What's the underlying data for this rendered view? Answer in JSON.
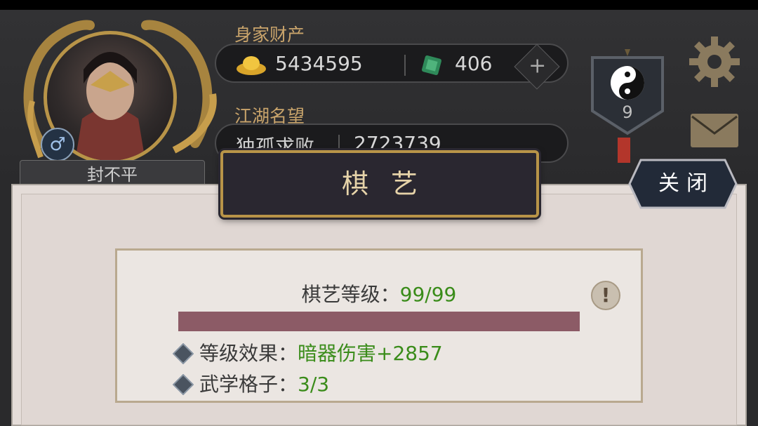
{
  "player": {
    "name": "封不平",
    "gender_symbol": "♂"
  },
  "wealth": {
    "label": "身家财产",
    "gold": "5434595",
    "jade": "406",
    "add_symbol": "+"
  },
  "reputation": {
    "label": "江湖名望",
    "title": "独孤求败",
    "value": "2723739"
  },
  "rank": {
    "level": "9"
  },
  "dialog": {
    "title": "棋艺",
    "close_label": "关闭",
    "level_label": "棋艺等级：",
    "level_value": "99/99",
    "level_progress": 1.0,
    "effect_label": "等级效果：",
    "effect_value": "暗器伤害+2857",
    "slot_label": "武学格子：",
    "slot_value": "3/3",
    "tip_symbol": "!"
  },
  "colors": {
    "accent_gold": "#b89448",
    "value_green": "#3a8c1a",
    "bar_fill": "#8c5b66"
  },
  "icons": [
    "gold-ingot-icon",
    "jade-icon",
    "plus-icon",
    "yin-yang-icon",
    "gear-icon",
    "mail-icon",
    "gem-bullet-icon",
    "info-icon",
    "male-icon"
  ]
}
